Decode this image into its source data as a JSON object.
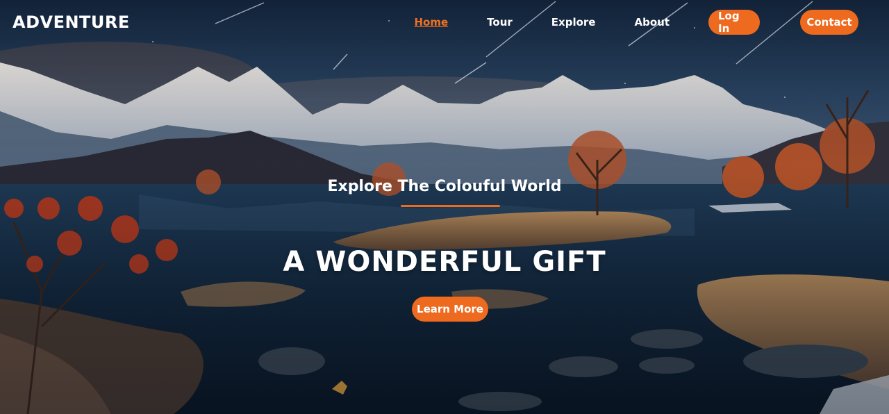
{
  "brand": {
    "logo": "ADVENTURE",
    "accent": "#ee6a1e"
  },
  "nav": {
    "links": [
      {
        "label": "Home",
        "active": true
      },
      {
        "label": "Tour",
        "active": false
      },
      {
        "label": "Explore",
        "active": false
      },
      {
        "label": "About",
        "active": false
      }
    ],
    "login_label": "Log In",
    "contact_label": "Contact"
  },
  "hero": {
    "subtitle": "Explore The Colouful World",
    "headline": "A WONDERFUL GIFT",
    "cta_label": "Learn More",
    "background": "night-mountain-lake-illustration"
  }
}
